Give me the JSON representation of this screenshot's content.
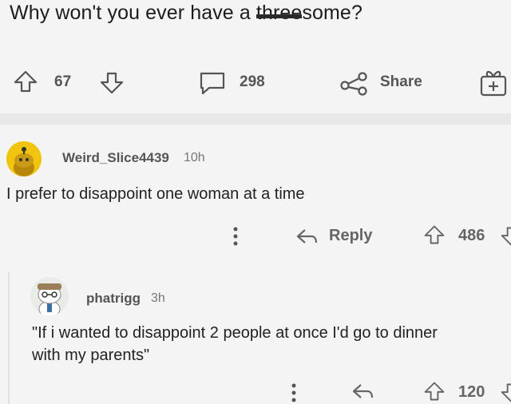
{
  "post": {
    "title_before": "Why won't you ever have a ",
    "title_struck": "three",
    "title_after": "some?",
    "upvotes": "67",
    "comments": "298",
    "share_label": "Share"
  },
  "comment1": {
    "username": "Weird_Slice4439",
    "time": "10h",
    "text": "I prefer to disappoint one woman at a time",
    "reply_label": "Reply",
    "upvotes": "486"
  },
  "comment2": {
    "username": "phatrigg",
    "time": "3h",
    "text_line1": "\"If i wanted to disappoint 2 people at once I'd go to dinner",
    "text_line2": "with my parents\"",
    "upvotes": "120"
  },
  "icons": {
    "upvote": "arrow-up-icon",
    "downvote": "arrow-down-icon",
    "comment": "comment-bubble-icon",
    "share": "share-icon",
    "award": "award-icon",
    "reply": "reply-arrow-icon",
    "more": "more-vertical-icon"
  },
  "colors": {
    "avatar1_bg": "#f1c40f",
    "avatar2_bg": "#e9ece6",
    "background": "#f4f4f4",
    "band": "#e8e8e8"
  }
}
